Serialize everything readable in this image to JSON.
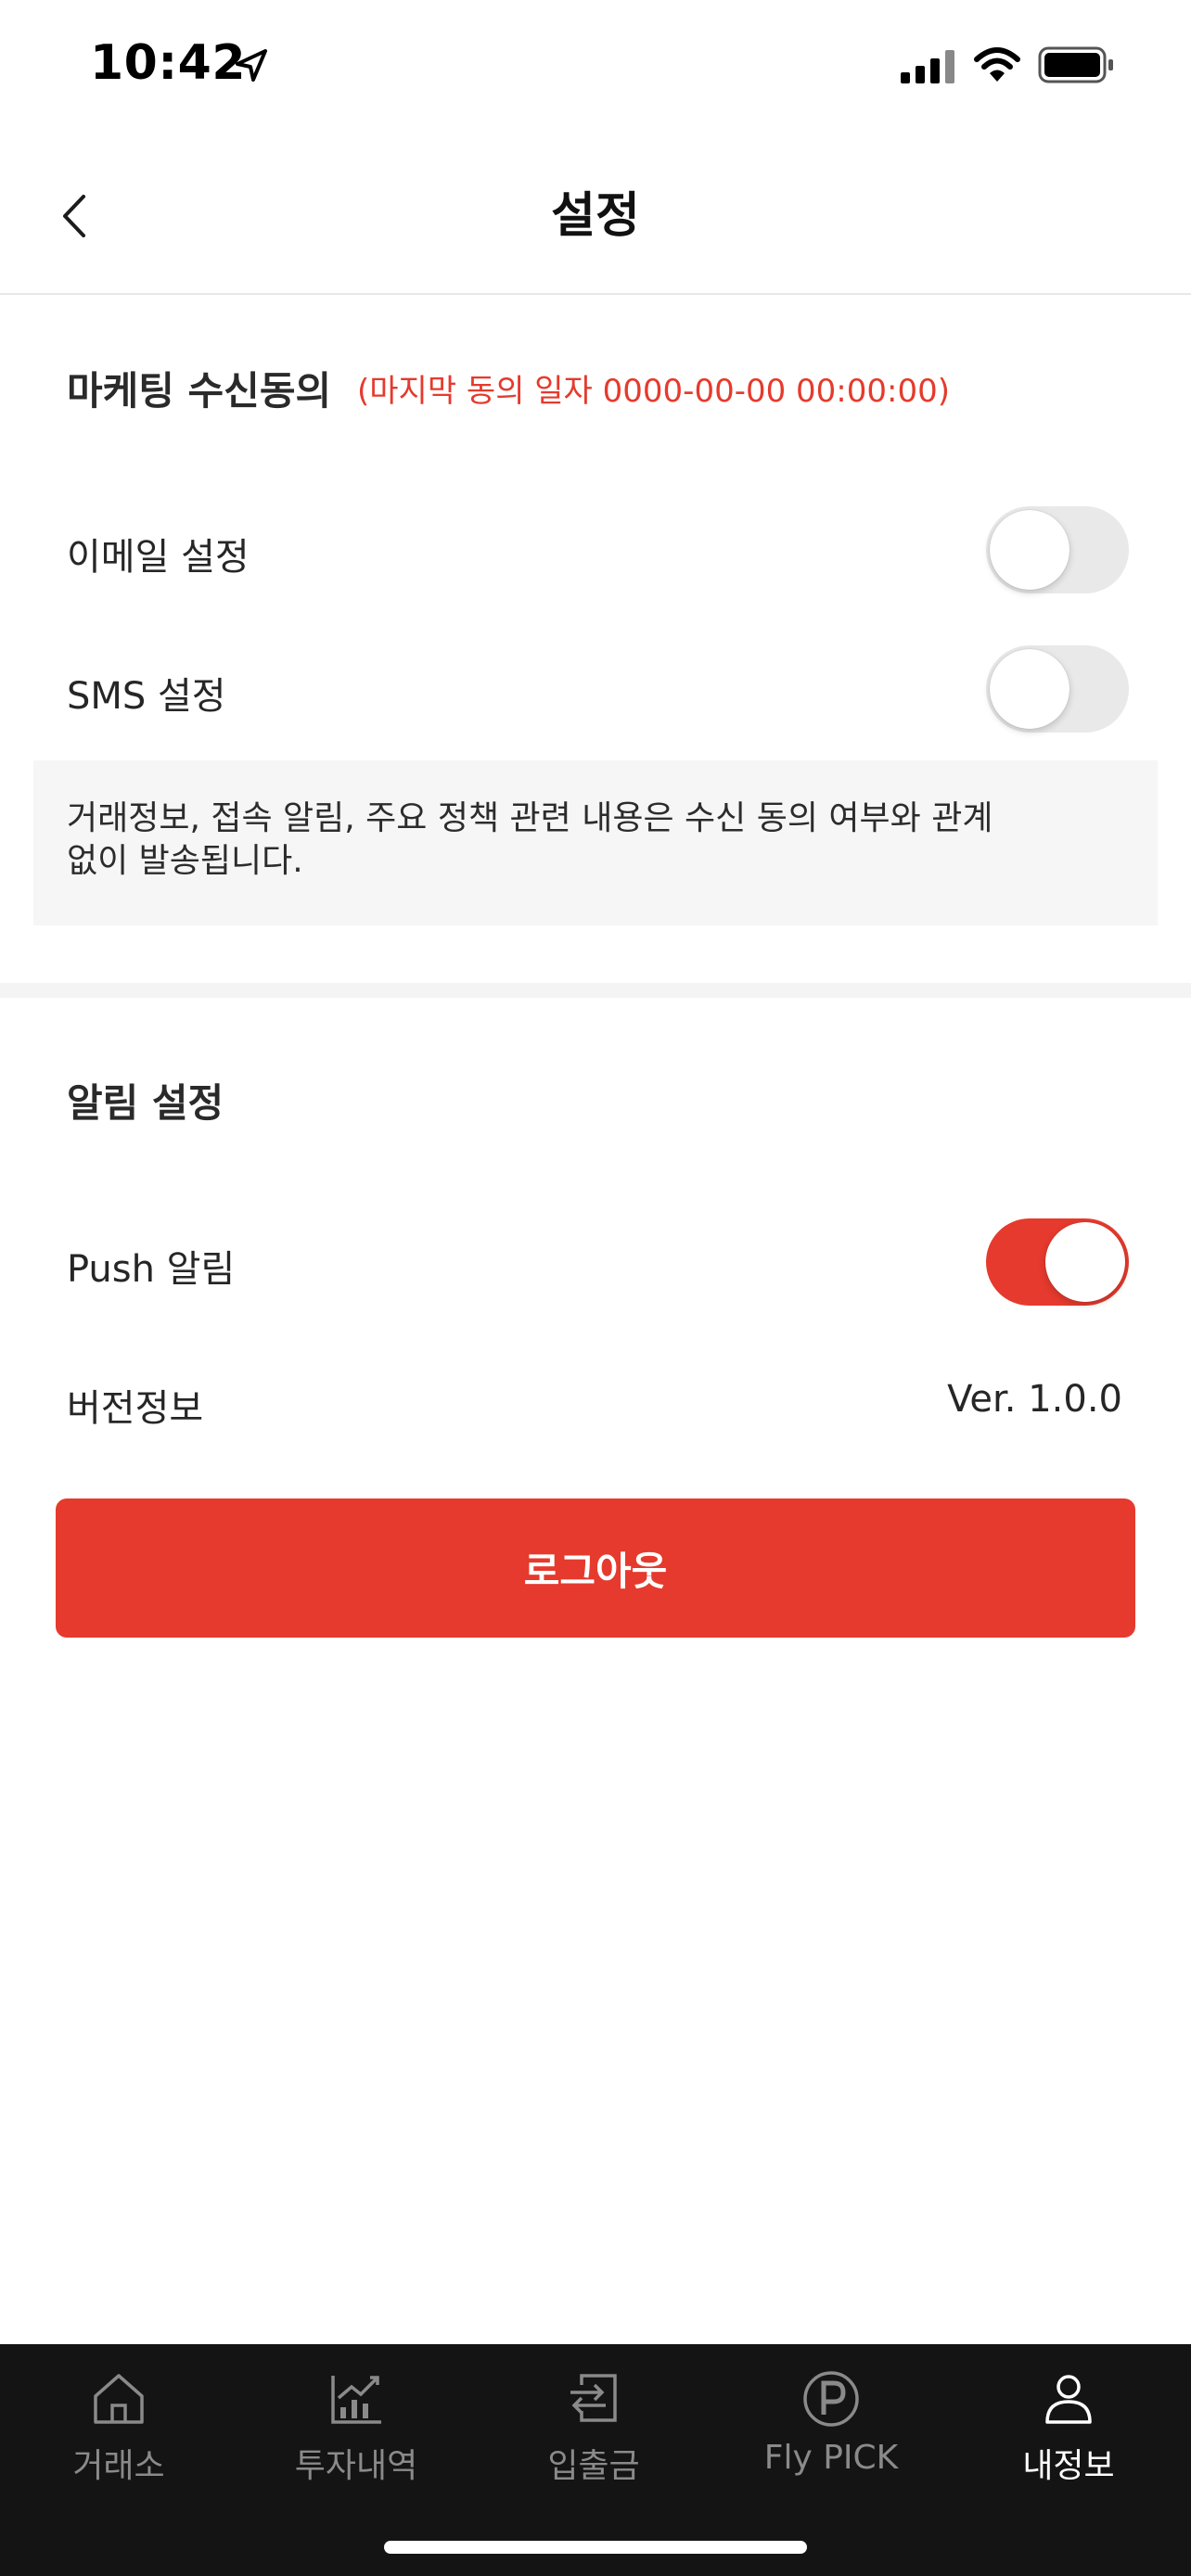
{
  "status_bar": {
    "time": "10:42"
  },
  "header": {
    "title": "설정"
  },
  "marketing": {
    "title": "마케팅 수신동의",
    "last_consent": "(마지막 동의 일자 0000-00-00 00:00:00)",
    "email_label": "이메일 설정",
    "email_enabled": false,
    "sms_label": "SMS 설정",
    "sms_enabled": false,
    "notice": "거래정보, 접속 알림, 주요 정책 관련 내용은 수신 동의 여부와 관계없이 발송됩니다."
  },
  "notifications": {
    "title": "알림 설정",
    "push_label": "Push 알림",
    "push_enabled": true,
    "version_label": "버전정보",
    "version_value": "Ver. 1.0.0"
  },
  "logout_label": "로그아웃",
  "bottom_nav": {
    "items": [
      {
        "label": "거래소",
        "icon": "home-icon",
        "active": false
      },
      {
        "label": "투자내역",
        "icon": "chart-icon",
        "active": false
      },
      {
        "label": "입출금",
        "icon": "transfer-icon",
        "active": false
      },
      {
        "label": "Fly PICK",
        "icon": "p-circle-icon",
        "active": false
      },
      {
        "label": "내정보",
        "icon": "person-icon",
        "active": true
      }
    ]
  },
  "colors": {
    "accent": "#e53a2d",
    "nav_background": "#141414",
    "toggle_off": "#e9e9ea"
  }
}
